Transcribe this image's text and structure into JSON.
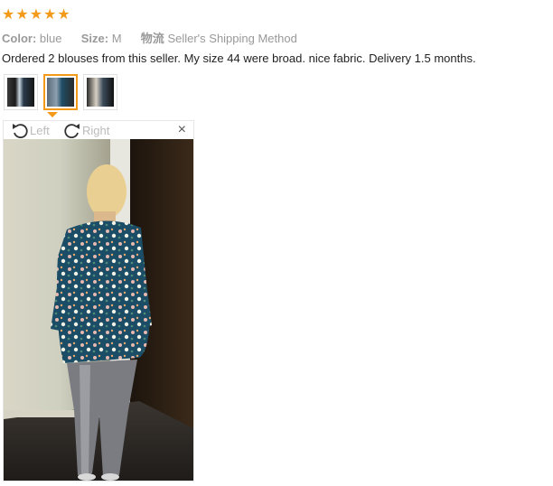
{
  "rating": {
    "stars": 5
  },
  "attributes": {
    "color_label": "Color:",
    "color_value": "blue",
    "size_label": "Size:",
    "size_value": "M",
    "shipping_label": "物流",
    "shipping_value": "Seller's Shipping Method"
  },
  "review_text": "Ordered 2 blouses from this seller. My size 44 were broad. nice fabric. Delivery 1.5 months.",
  "thumbnails": {
    "count": 3,
    "active_index": 1
  },
  "viewer": {
    "rotate_left_label": "Left",
    "rotate_right_label": "Right",
    "close_symbol": "×"
  },
  "colors": {
    "accent": "#f39a1b",
    "muted_text": "#999999"
  },
  "icons": [
    "star-icon",
    "rotate-left-icon",
    "rotate-right-icon",
    "close-icon"
  ]
}
